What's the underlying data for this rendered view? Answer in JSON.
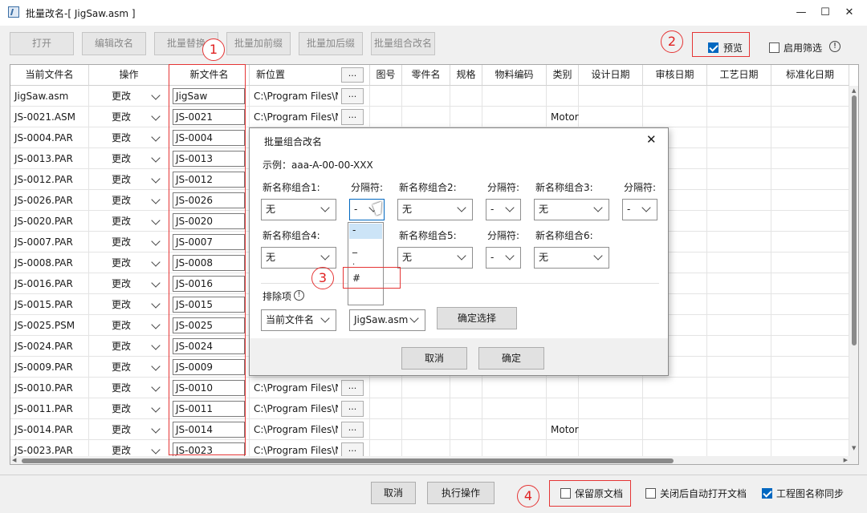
{
  "window": {
    "title": "批量改名-[ JigSaw.asm ]",
    "minimize": "—",
    "maximize": "☐",
    "close": "✕"
  },
  "toolbar": {
    "open": "打开",
    "edit_rename": "编辑改名",
    "batch_replace": "批量替换",
    "batch_prefix": "批量加前缀",
    "batch_suffix": "批量加后缀",
    "batch_combine": "批量组合改名",
    "preview": "预览",
    "enable_filter": "启用筛选",
    "info": "!"
  },
  "annotations": {
    "a1": "1",
    "a2": "2",
    "a3": "3",
    "a4": "4"
  },
  "columns": [
    "当前文件名",
    "操作",
    "新文件名",
    "新位置",
    "图号",
    "零件名",
    "规格",
    "物料编码",
    "类别",
    "设计日期",
    "审核日期",
    "工艺日期",
    "标准化日期"
  ],
  "path_browse": "...",
  "rows": [
    {
      "current": "JigSaw.asm",
      "op": "更改",
      "new": "JigSaw",
      "path": "C:\\Program Files\\NE",
      "cat": ""
    },
    {
      "current": "JS-0021.ASM",
      "op": "更改",
      "new": "JS-0021",
      "path": "C:\\Program Files\\NE",
      "cat": "Motor"
    },
    {
      "current": "JS-0004.PAR",
      "op": "更改",
      "new": "JS-0004",
      "path": "",
      "cat": ""
    },
    {
      "current": "JS-0013.PAR",
      "op": "更改",
      "new": "JS-0013",
      "path": "",
      "cat": ""
    },
    {
      "current": "JS-0012.PAR",
      "op": "更改",
      "new": "JS-0012",
      "path": "",
      "cat": ""
    },
    {
      "current": "JS-0026.PAR",
      "op": "更改",
      "new": "JS-0026",
      "path": "",
      "cat": ""
    },
    {
      "current": "JS-0020.PAR",
      "op": "更改",
      "new": "JS-0020",
      "path": "",
      "cat": ""
    },
    {
      "current": "JS-0007.PAR",
      "op": "更改",
      "new": "JS-0007",
      "path": "",
      "cat": ""
    },
    {
      "current": "JS-0008.PAR",
      "op": "更改",
      "new": "JS-0008",
      "path": "",
      "cat": ""
    },
    {
      "current": "JS-0016.PAR",
      "op": "更改",
      "new": "JS-0016",
      "path": "",
      "cat": ""
    },
    {
      "current": "JS-0015.PAR",
      "op": "更改",
      "new": "JS-0015",
      "path": "",
      "cat": ""
    },
    {
      "current": "JS-0025.PSM",
      "op": "更改",
      "new": "JS-0025",
      "path": "",
      "cat": ""
    },
    {
      "current": "JS-0024.PAR",
      "op": "更改",
      "new": "JS-0024",
      "path": "",
      "cat": ""
    },
    {
      "current": "JS-0009.PAR",
      "op": "更改",
      "new": "JS-0009",
      "path": "",
      "cat": ""
    },
    {
      "current": "JS-0010.PAR",
      "op": "更改",
      "new": "JS-0010",
      "path": "C:\\Program Files\\NE",
      "cat": ""
    },
    {
      "current": "JS-0011.PAR",
      "op": "更改",
      "new": "JS-0011",
      "path": "C:\\Program Files\\NE",
      "cat": ""
    },
    {
      "current": "JS-0014.PAR",
      "op": "更改",
      "new": "JS-0014",
      "path": "C:\\Program Files\\NE",
      "cat": "Motor"
    },
    {
      "current": "JS-0023.PAR",
      "op": "更改",
      "new": "JS-0023",
      "path": "C:\\Program Files\\NE",
      "cat": ""
    }
  ],
  "dialog": {
    "title": "批量组合改名",
    "close": "✕",
    "example": "示例：aaa-A-00-00-XXX",
    "combo1": "新名称组合1:",
    "combo2": "新名称组合2:",
    "combo3": "新名称组合3:",
    "combo4": "新名称组合4:",
    "combo5": "新名称组合5:",
    "combo6": "新名称组合6:",
    "sep": "分隔符:",
    "none": "无",
    "dash": "-",
    "exclude": "排除项",
    "exclude_field": "当前文件名",
    "exclude_value": "JigSaw.asm",
    "confirm_select": "确定选择",
    "cancel": "取消",
    "ok": "确定",
    "dropdown": [
      "-",
      "_",
      ".",
      "#"
    ]
  },
  "bottom": {
    "cancel": "取消",
    "execute": "执行操作",
    "keep_original": "保留原文档",
    "auto_open": "关闭后自动打开文档",
    "drawing_sync": "工程图名称同步"
  },
  "colors": {
    "accent": "#0067c0",
    "annotation": "#e53535"
  }
}
